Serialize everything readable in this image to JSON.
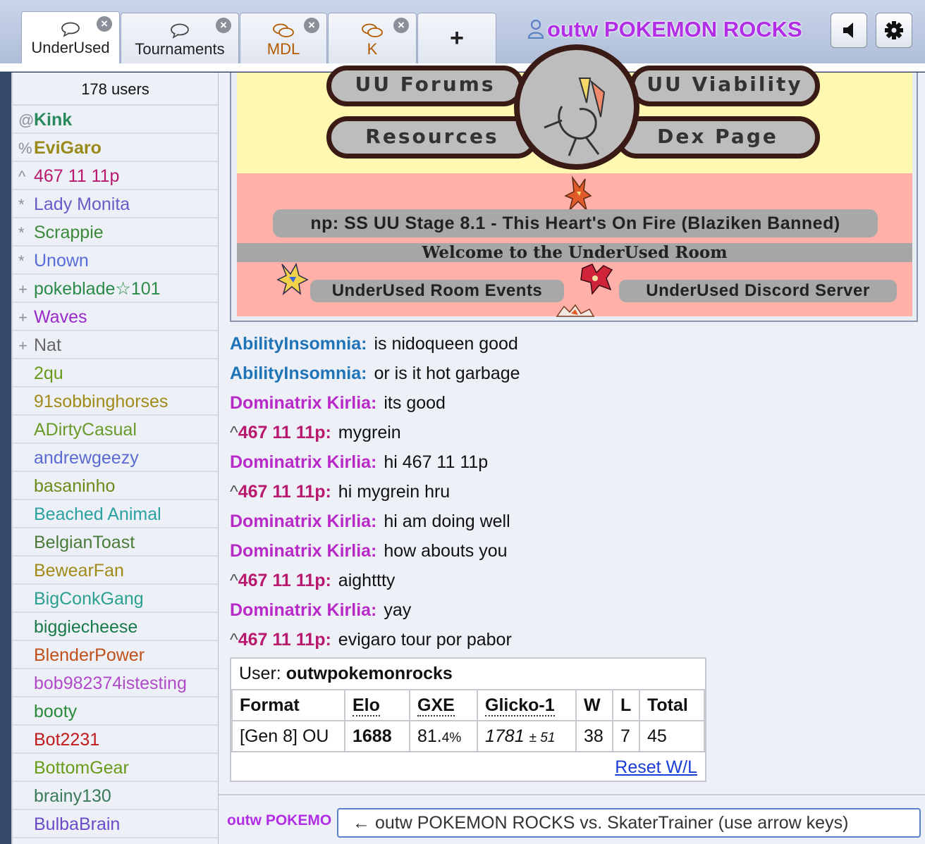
{
  "tabs": [
    {
      "label": "UnderUsed",
      "icon": "chat-bubble-icon",
      "active": true
    },
    {
      "label": "Tournaments",
      "icon": "chat-bubble-icon"
    },
    {
      "label": "MDL",
      "icon": "group-chat-icon"
    },
    {
      "label": "K",
      "icon": "group-chat-icon"
    }
  ],
  "add_tab_label": "+",
  "header": {
    "username": "outw POKEMON ROCKS"
  },
  "userlist": {
    "count": "178 users",
    "users": [
      {
        "rank": "@",
        "name": "Kink",
        "color": "#2a8a5c"
      },
      {
        "rank": "%",
        "name": "EviGaro",
        "color": "#9a8a1a"
      },
      {
        "rank": "^",
        "name": "467 11 11p",
        "color": "#b8196e"
      },
      {
        "rank": "*",
        "name": "Lady Monita",
        "color": "#6a5ac8"
      },
      {
        "rank": "*",
        "name": "Scrappie",
        "color": "#3a8a3a"
      },
      {
        "rank": "*",
        "name": "Unown",
        "color": "#5a6ad8"
      },
      {
        "rank": "+",
        "name": "pokeblade☆101",
        "color": "#2a8a4a"
      },
      {
        "rank": "+",
        "name": "Waves",
        "color": "#9a2ac8"
      },
      {
        "rank": "+",
        "name": "Nat",
        "color": "#666666"
      },
      {
        "rank": "",
        "name": "2qu",
        "color": "#6a9a1a"
      },
      {
        "rank": "",
        "name": "91sobbinghorses",
        "color": "#a08a1a"
      },
      {
        "rank": "",
        "name": "ADirtyCasual",
        "color": "#6a9a2a"
      },
      {
        "rank": "",
        "name": "andrewgeezy",
        "color": "#5a6ad0"
      },
      {
        "rank": "",
        "name": "basaninho",
        "color": "#6a8a1a"
      },
      {
        "rank": "",
        "name": "Beached Animal",
        "color": "#2aa0a0"
      },
      {
        "rank": "",
        "name": "BelgianToast",
        "color": "#4a7a3a"
      },
      {
        "rank": "",
        "name": "BewearFan",
        "color": "#a08a1a"
      },
      {
        "rank": "",
        "name": "BigConkGang",
        "color": "#2aa090"
      },
      {
        "rank": "",
        "name": "biggiecheese",
        "color": "#1a7a4a"
      },
      {
        "rank": "",
        "name": "BlenderPower",
        "color": "#c0501a"
      },
      {
        "rank": "",
        "name": "bob982374istesting",
        "color": "#b04ac8"
      },
      {
        "rank": "",
        "name": "booty",
        "color": "#2a8a3a"
      },
      {
        "rank": "",
        "name": "Bot2231",
        "color": "#c01a1a"
      },
      {
        "rank": "",
        "name": "BottomGear",
        "color": "#6a9a1a"
      },
      {
        "rank": "",
        "name": "brainy130",
        "color": "#3a7a5a"
      },
      {
        "rank": "",
        "name": "BulbaBrain",
        "color": "#6a4ac8"
      }
    ]
  },
  "banner": {
    "links": [
      "UU Forums",
      "UU Viability",
      "Resources",
      "Dex Page"
    ],
    "now_playing": "np: SS UU Stage 8.1 - This Heart's On Fire (Blaziken Banned)",
    "welcome": "Welcome to the UnderUsed Room",
    "events_button": "UnderUsed Room Events",
    "discord_button": "UnderUsed Discord Server"
  },
  "chat": [
    {
      "sym": "",
      "author": "AbilityInsomnia:",
      "color": "#1f74b8",
      "text": "is nidoqueen good"
    },
    {
      "sym": "",
      "author": "AbilityInsomnia:",
      "color": "#1f74b8",
      "text": "or is it hot garbage"
    },
    {
      "sym": "",
      "author": "Dominatrix Kirlia:",
      "color": "#b82ac8",
      "text": "its good"
    },
    {
      "sym": "^",
      "author": "467 11 11p:",
      "color": "#b8196e",
      "text": "mygrein"
    },
    {
      "sym": "",
      "author": "Dominatrix Kirlia:",
      "color": "#b82ac8",
      "text": "hi 467 11 11p"
    },
    {
      "sym": "^",
      "author": "467 11 11p:",
      "color": "#b8196e",
      "text": "hi mygrein hru"
    },
    {
      "sym": "",
      "author": "Dominatrix Kirlia:",
      "color": "#b82ac8",
      "text": "hi am doing well"
    },
    {
      "sym": "",
      "author": "Dominatrix Kirlia:",
      "color": "#b82ac8",
      "text": "how abouts you"
    },
    {
      "sym": "^",
      "author": "467 11 11p:",
      "color": "#b8196e",
      "text": "aighttty"
    },
    {
      "sym": "",
      "author": "Dominatrix Kirlia:",
      "color": "#b82ac8",
      "text": "yay"
    },
    {
      "sym": "^",
      "author": "467 11 11p:",
      "color": "#b8196e",
      "text": "evigaro tour por pabor"
    }
  ],
  "rating": {
    "user_label": "User:",
    "user": "outwpokemonrocks",
    "headers": [
      "Format",
      "Elo",
      "GXE",
      "Glicko-1",
      "W",
      "L",
      "Total"
    ],
    "row": {
      "format": "[Gen 8] OU",
      "elo": "1688",
      "gxe": "81.",
      "gxe_small": "4%",
      "glicko": "1781",
      "glicko_dev": "± 51",
      "w": "38",
      "l": "7",
      "total": "45"
    },
    "reset": "Reset W/L"
  },
  "bottom": {
    "name": "outw POKEMON ROCKS",
    "input_text": "← outw POKEMON ROCKS vs. SkaterTrainer (use arrow keys)"
  }
}
